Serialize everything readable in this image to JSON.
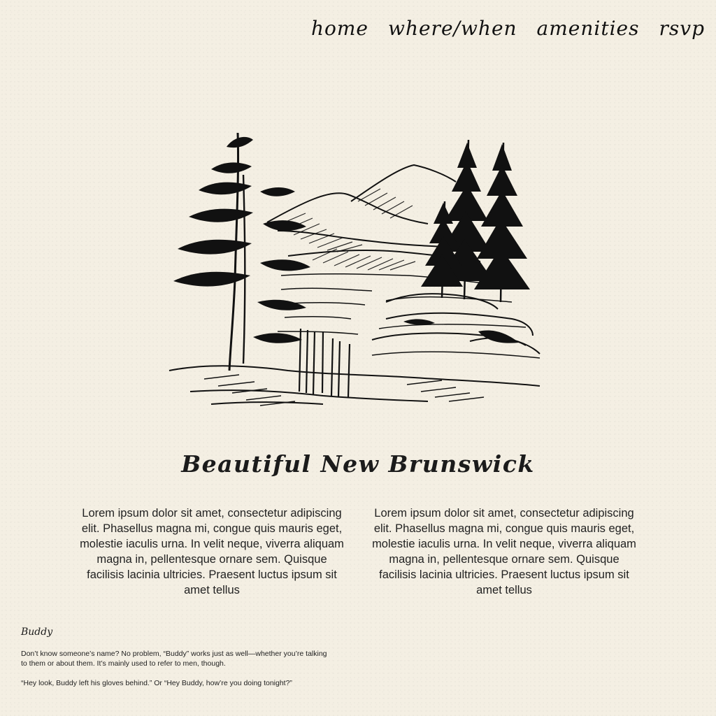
{
  "nav": {
    "items": [
      {
        "label": "home"
      },
      {
        "label": "where/when"
      },
      {
        "label": "amenities"
      },
      {
        "label": "rsvp"
      }
    ]
  },
  "hero": {
    "icon": "mountain-lake-illustration",
    "title": "Beautiful New Brunswick"
  },
  "content": {
    "columns": [
      {
        "text": "Lorem ipsum dolor sit amet, consectetur adipiscing elit. Phasellus magna mi, congue quis mauris eget, molestie iaculis urna. In velit neque, viverra aliquam magna in, pellentesque ornare sem. Quisque facilisis lacinia ultricies. Praesent luctus ipsum sit amet tellus"
      },
      {
        "text": "Lorem ipsum dolor sit amet, consectetur adipiscing elit. Phasellus magna mi, congue quis mauris eget, molestie iaculis urna. In velit neque, viverra aliquam magna in, pellentesque ornare sem. Quisque facilisis lacinia ultricies. Praesent luctus ipsum sit amet tellus"
      }
    ]
  },
  "buddy": {
    "title": "Buddy",
    "paragraphs": [
      "Don’t know someone’s name? No problem, “Buddy” works just as well—whether you’re talking to them or about them. It’s mainly used to refer to men, though.",
      "“Hey look, Buddy left his gloves behind.” Or “Hey Buddy, how’re you doing tonight?”"
    ]
  },
  "colors": {
    "background": "#f4efe3",
    "ink": "#1b1b1b"
  }
}
